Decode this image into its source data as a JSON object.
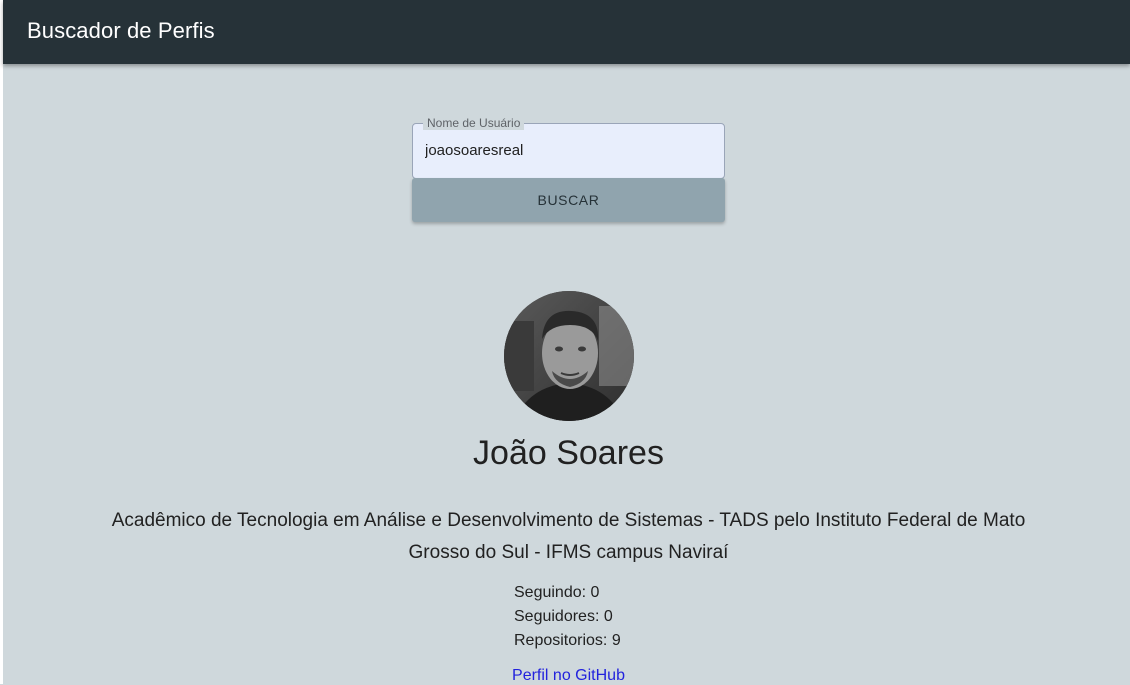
{
  "app": {
    "title": "Buscador de Perfis"
  },
  "search": {
    "label": "Nome de Usuário",
    "value": "joaosoaresreal",
    "button_label": "BUSCAR"
  },
  "profile": {
    "name": "João Soares",
    "bio": "Acadêmico de Tecnologia em Análise e Desenvolvimento de Sistemas - TADS pelo Instituto Federal de Mato Grosso do Sul - IFMS campus Naviraí",
    "stats": [
      {
        "label": "Seguindo:",
        "value": "0"
      },
      {
        "label": "Seguidores:",
        "value": "0"
      },
      {
        "label": "Repositorios:",
        "value": "9"
      }
    ],
    "github_link": "Perfil no GitHub"
  },
  "colors": {
    "appbar": "#263238",
    "background": "#cfd8dc",
    "button": "#90a4ae",
    "input": "#e8eefc",
    "link": "#2222dd"
  }
}
